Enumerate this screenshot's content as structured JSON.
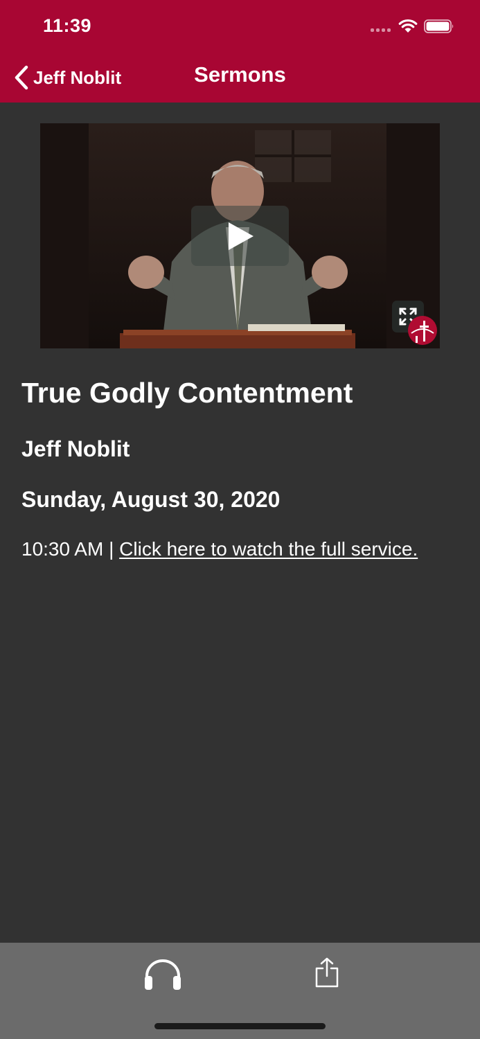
{
  "status_bar": {
    "time": "11:39"
  },
  "nav": {
    "back_label": "Jeff Noblit",
    "title": "Sermons"
  },
  "video": {
    "play_icon": "play-icon",
    "expand_icon": "expand-icon",
    "logo": "church-cross-logo"
  },
  "sermon": {
    "title": "True Godly Contentment",
    "preacher": "Jeff Noblit",
    "date": "Sunday, August 30, 2020",
    "time": "10:30 AM",
    "separator": " | ",
    "full_service_link": "Click here to watch the full service."
  },
  "toolbar": {
    "audio_icon": "headphones-icon",
    "share_icon": "share-icon"
  },
  "colors": {
    "brand": "#a80633",
    "background": "#323232",
    "toolbar": "#6b6b6b",
    "text": "#ffffff"
  }
}
